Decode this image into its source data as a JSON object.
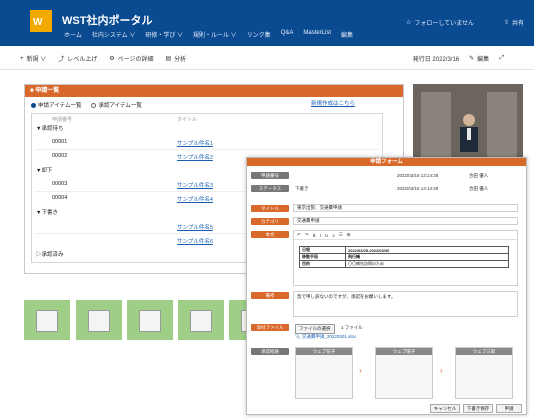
{
  "header": {
    "site_title": "WST社内ポータル",
    "nav": [
      "ホーム",
      "社内システム ∨",
      "研修・学び ∨",
      "規則・ルール ∨",
      "リンク集",
      "Q&A",
      "MasterList",
      "編集"
    ],
    "follow": "フォローしていません",
    "share": "共有"
  },
  "cmdbar": {
    "new": "新規 ∨",
    "level_up": "レベル上げ",
    "page_detail": "ページの詳細",
    "analytics": "分析",
    "published": "発行日 2022/3/16",
    "edit": "編集"
  },
  "panel": {
    "title": "申請一覧",
    "radio_1": "申請アイテム一覧",
    "radio_2": "承認アイテム一覧",
    "new_link": "新規作成はこちら",
    "col_id": "申請番号",
    "col_title": "タイトル",
    "groups": [
      "▼承認待ち",
      "▼却下",
      "▼下書き",
      "▷承認済み"
    ],
    "rows": [
      {
        "id": "00001",
        "title": "サンプル件名1"
      },
      {
        "id": "00002",
        "title": "サンプル件名2"
      },
      {
        "id": "00003",
        "title": "サンプル件名3"
      },
      {
        "id": "00004",
        "title": "サンプル件名4"
      },
      {
        "id": "",
        "title": "サンプル件名5"
      },
      {
        "id": "",
        "title": "サンプル件名6"
      }
    ]
  },
  "form": {
    "title": "申請フォーム",
    "lbl_no": "申請番号",
    "lbl_status": "ステータス",
    "status_value": "下書き",
    "created": "2022/03/16 13:14:28",
    "created_by": "合田 優人",
    "modified": "2022/03/16 13:14:28",
    "modified_by": "合田 優人",
    "lbl_title": "タイトル",
    "title_value": "東京出張：交通費申請",
    "lbl_category": "カテゴリ",
    "category_value": "交通費申請",
    "lbl_body": "本文",
    "table": [
      [
        "日程",
        "2022/03/28-2022/03/30"
      ],
      [
        "移動手段",
        "飛行機"
      ],
      [
        "目的",
        "〇〇様先訪問のため"
      ]
    ],
    "lbl_notes": "備考",
    "notes": "急で申し訳ないのですが、承認をお願いします。",
    "lbl_attach": "添付ファイル",
    "file_btn": "ファイルの選択",
    "file_count": "1 ファイル",
    "file_name": "交通費申請_20220301.xlsx",
    "lbl_route": "承認経路",
    "approvers": [
      "ウェブ花子",
      "ウェブ陽子",
      "ウェブ三郎"
    ],
    "btn_cancel": "キャンセル",
    "btn_draft": "下書き保存",
    "btn_apply": "申請"
  }
}
